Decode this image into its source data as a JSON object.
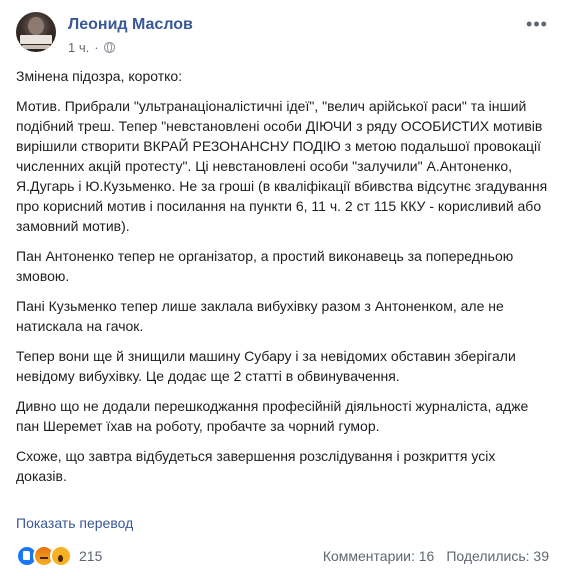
{
  "post": {
    "author": "Леонид Маслов",
    "time": "1 ч.",
    "separator": "·",
    "more_glyph": "•••",
    "privacy_icon": "globe-icon",
    "paragraphs": [
      "Змінена підозра, коротко:",
      "Мотив. Прибрали \"ультранаціоналістичні ідеї\", \"велич арійської раси\" та інший подібний треш. Тепер \"невстановлені особи ДІЮЧИ з ряду ОСОБИСТИХ мотивів вирішили створити ВКРАЙ РЕЗОНАНСНУ ПОДІЮ з метою подальшої провокації численних акцій протесту\". Ці невстановлені особи \"залучили\" А.Антоненко, Я.Дугарь і Ю.Кузьменко. Не за гроші (в кваліфікації вбивства відсутнє згадування про корисний мотив і посилання на пункти 6, 11 ч. 2 ст 115 ККУ - корисливий або замовний мотив).",
      "Пан Антоненко тепер не організатор, а простий виконавець за попередньою змовою.",
      "Пані Кузьменко тепер лише заклала вибухівку разом з Антоненком, але не натискала на гачок.",
      "Тепер вони ще й знищили машину Субару і за невідомих обставин зберігали невідому вибухівку. Це додає ще 2 статті в обвинувачення.",
      "Дивно що не додали перешкоджання професійній діяльності журналіста, адже пан Шеремет їхав на роботу, пробачте за чорний гумор.",
      "Схоже, що завтра відбудеться завершення розслідування і розкриття усіх доказів."
    ],
    "translate_link": "Показать перевод"
  },
  "footer": {
    "reaction_icons": [
      "like-icon",
      "angry-icon",
      "wow-icon"
    ],
    "reaction_count": "215",
    "comments": "Комментарии: 16",
    "shares": "Поделились: 39"
  },
  "colors": {
    "link": "#385898",
    "text": "#1c1e21",
    "muted": "#606770"
  }
}
